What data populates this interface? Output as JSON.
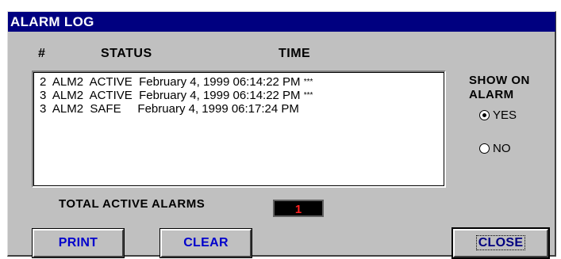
{
  "window": {
    "title": "ALARM LOG"
  },
  "columns": {
    "num": "#",
    "status": "STATUS",
    "time": "TIME"
  },
  "log": [
    {
      "num": "2",
      "alarm": "ALM2",
      "state": "ACTIVE",
      "time": "February 4, 1999 06:14:22 PM",
      "flag": "***"
    },
    {
      "num": "3",
      "alarm": "ALM2",
      "state": "ACTIVE",
      "time": "February 4, 1999 06:14:22 PM",
      "flag": "***"
    },
    {
      "num": "3",
      "alarm": "ALM2",
      "state": "SAFE",
      "time": "February 4, 1999 06:17:24 PM",
      "flag": ""
    }
  ],
  "show_on_alarm": {
    "label_line1": "SHOW ON",
    "label_line2": "ALARM",
    "options": [
      {
        "label": "YES",
        "selected": true
      },
      {
        "label": "NO",
        "selected": false
      }
    ]
  },
  "total": {
    "label": "TOTAL ACTIVE ALARMS",
    "value": "1"
  },
  "buttons": {
    "print": "PRINT",
    "clear": "CLEAR",
    "close": "CLOSE"
  },
  "colors": {
    "titlebar": "#000080",
    "button_text": "#0000cc",
    "counter_text": "#ff2020"
  }
}
